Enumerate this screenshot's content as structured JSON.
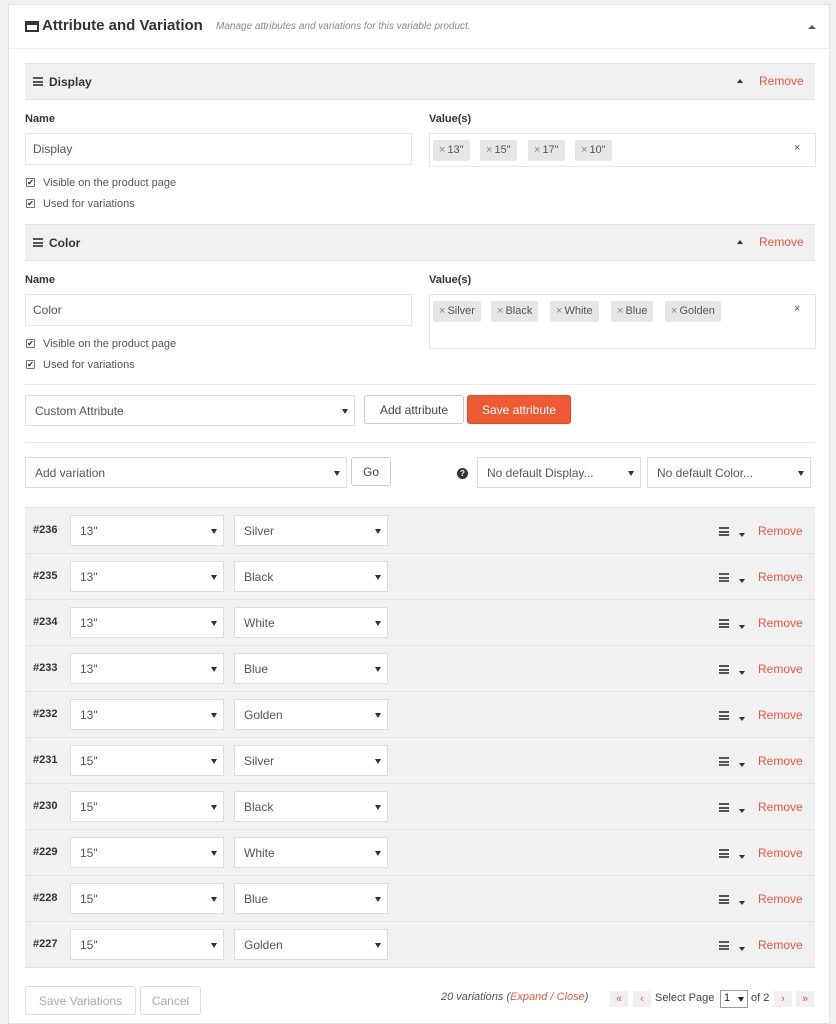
{
  "header": {
    "title": "Attribute and Variation",
    "subtitle": "Manage attributes and variations for this variable product."
  },
  "attributes": [
    {
      "title": "Display",
      "remove_label": "Remove",
      "name_label": "Name",
      "name_value": "Display",
      "values_label": "Value(s)",
      "values": [
        "13\"",
        "15\"",
        "17\"",
        "10\""
      ],
      "visible_label": "Visible on the product page",
      "visible_checked": true,
      "variations_label": "Used for variations",
      "variations_checked": true
    },
    {
      "title": "Color",
      "remove_label": "Remove",
      "name_label": "Name",
      "name_value": "Color",
      "values_label": "Value(s)",
      "values": [
        "Silver",
        "Black",
        "White",
        "Blue",
        "Golden"
      ],
      "visible_label": "Visible on the product page",
      "visible_checked": true,
      "variations_label": "Used for variations",
      "variations_checked": true
    }
  ],
  "tag_remove_glyph": "×",
  "clear_glyph": "×",
  "attribute_toolbar": {
    "select_value": "Custom Attribute",
    "add_label": "Add attribute",
    "save_label": "Save attribute"
  },
  "variation_toolbar": {
    "select_value": "Add variation",
    "go_label": "Go",
    "default_display": "No default Display...",
    "default_color": "No default Color..."
  },
  "variations": [
    {
      "id": "#236",
      "display": "13\"",
      "color": "Silver",
      "remove": "Remove"
    },
    {
      "id": "#235",
      "display": "13\"",
      "color": "Black",
      "remove": "Remove"
    },
    {
      "id": "#234",
      "display": "13\"",
      "color": "White",
      "remove": "Remove"
    },
    {
      "id": "#233",
      "display": "13\"",
      "color": "Blue",
      "remove": "Remove"
    },
    {
      "id": "#232",
      "display": "13\"",
      "color": "Golden",
      "remove": "Remove"
    },
    {
      "id": "#231",
      "display": "15\"",
      "color": "Silver",
      "remove": "Remove"
    },
    {
      "id": "#230",
      "display": "15\"",
      "color": "Black",
      "remove": "Remove"
    },
    {
      "id": "#229",
      "display": "15\"",
      "color": "White",
      "remove": "Remove"
    },
    {
      "id": "#228",
      "display": "15\"",
      "color": "Blue",
      "remove": "Remove"
    },
    {
      "id": "#227",
      "display": "15\"",
      "color": "Golden",
      "remove": "Remove"
    }
  ],
  "footer": {
    "save_variations_label": "Save Variations",
    "cancel_label": "Cancel",
    "count_text": "20 variations (",
    "expand_label": "Expand",
    "slash": " / ",
    "close_label": "Close",
    "close_paren": ")",
    "first_glyph": "«",
    "prev_glyph": "‹",
    "select_page_label": "Select Page",
    "current_page": "1",
    "of_label": "of 2",
    "next_glyph": "›",
    "last_glyph": "»"
  },
  "colors": {
    "accent": "#ee5a33",
    "remove_link": "#e9573f"
  }
}
